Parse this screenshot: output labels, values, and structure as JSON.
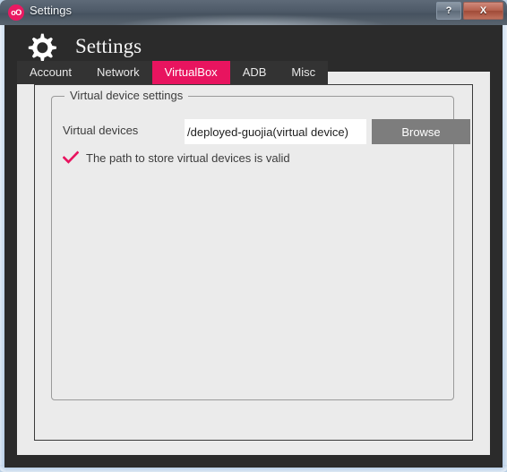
{
  "window": {
    "title": "Settings",
    "app_icon_text": "oO",
    "accent_color": "#e8145f",
    "buttons": {
      "help": "?",
      "close": "X"
    }
  },
  "header": {
    "title": "Settings",
    "icon": "gear-icon"
  },
  "tabs": [
    {
      "label": "Account",
      "active": false
    },
    {
      "label": "Network",
      "active": false
    },
    {
      "label": "VirtualBox",
      "active": true
    },
    {
      "label": "ADB",
      "active": false
    },
    {
      "label": "Misc",
      "active": false
    }
  ],
  "groupbox": {
    "title": "Virtual device settings",
    "field": {
      "label": "Virtual devices",
      "value": "deployed-guojia(virtual device)/",
      "placeholder": "",
      "browse_label": "Browse"
    },
    "validation": {
      "icon": "check-icon",
      "color": "#e8145f",
      "message": "The path to store virtual devices is valid"
    }
  }
}
